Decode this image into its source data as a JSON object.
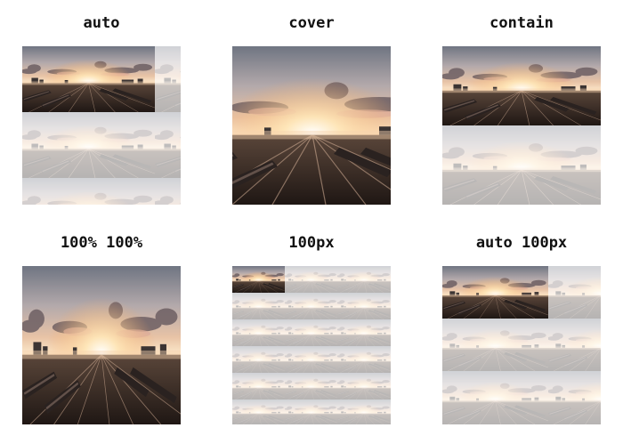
{
  "demo": {
    "cells": [
      {
        "label": "auto"
      },
      {
        "label": "cover"
      },
      {
        "label": "contain"
      },
      {
        "label": "100% 100%"
      },
      {
        "label": "100px"
      },
      {
        "label": "auto 100px"
      }
    ]
  }
}
